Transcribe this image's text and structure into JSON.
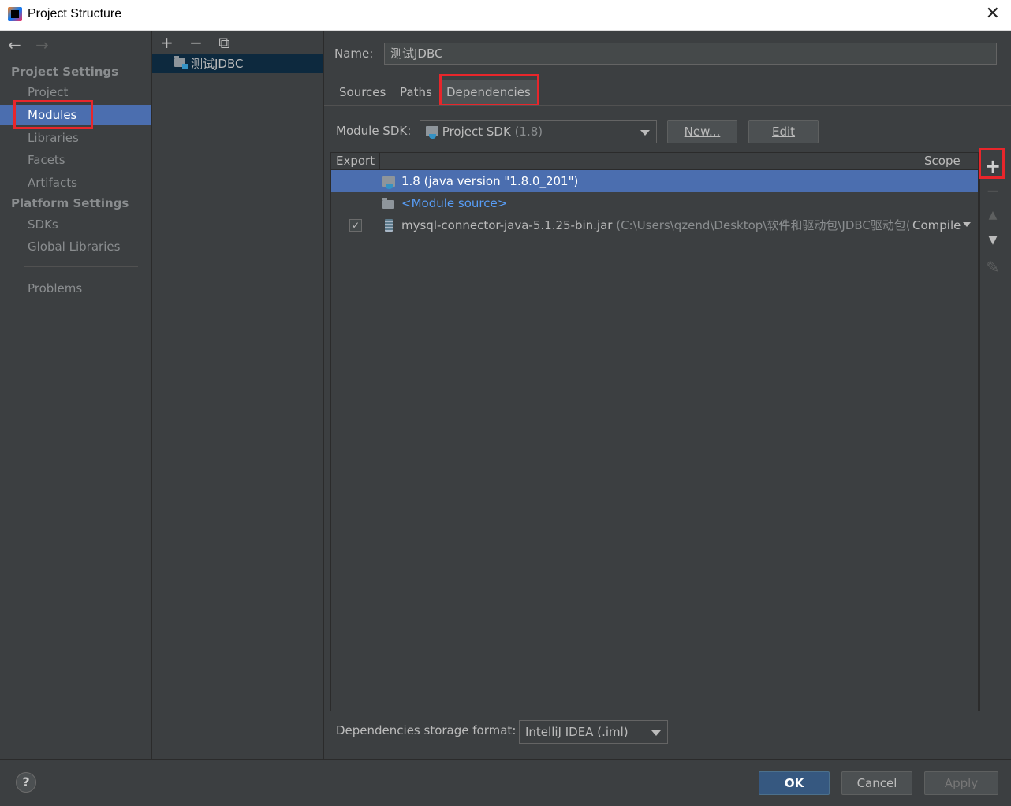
{
  "window": {
    "title": "Project Structure",
    "close_glyph": "✕"
  },
  "nav": {
    "back": "←",
    "forward": "→"
  },
  "sidebar": {
    "project_settings_header": "Project Settings",
    "project_items": [
      "Project",
      "Modules",
      "Libraries",
      "Facets",
      "Artifacts"
    ],
    "platform_settings_header": "Platform Settings",
    "platform_items": [
      "SDKs",
      "Global Libraries"
    ],
    "problems": "Problems",
    "selected": "Modules"
  },
  "modules_toolbar": {
    "add": "+",
    "remove": "−",
    "copy": "⧉"
  },
  "modules_list": [
    {
      "name": "测试JDBC"
    }
  ],
  "module": {
    "name_label": "Name:",
    "name_value": "测试JDBC",
    "tabs": [
      "Sources",
      "Paths",
      "Dependencies"
    ],
    "active_tab": "Dependencies",
    "sdk_label": "Module SDK:",
    "sdk_value": "Project SDK",
    "sdk_version": "(1.8)",
    "new_button": "New...",
    "edit_button": "Edit",
    "table": {
      "headers": {
        "export": "Export",
        "scope": "Scope"
      },
      "rows": [
        {
          "label": "1.8 (java version \"1.8.0_201\")",
          "icon": "jdk-icon",
          "selected": true
        },
        {
          "label": "<Module source>",
          "icon": "folder-icon",
          "link": true
        },
        {
          "label": "mysql-connector-java-5.1.25-bin.jar",
          "path": "(C:\\Users\\qzend\\Desktop\\软件和驱动包\\JDBC驱动包(c",
          "icon": "jar-icon",
          "export_checked": true,
          "scope": "Compile"
        }
      ]
    },
    "side_tools": {
      "add": "+",
      "remove": "−",
      "up": "▲",
      "down": "▼",
      "edit": "✎"
    },
    "storage_label": "Dependencies storage format:",
    "storage_value": "IntelliJ IDEA (.iml)"
  },
  "footer": {
    "help": "?",
    "ok": "OK",
    "cancel": "Cancel",
    "apply": "Apply"
  }
}
